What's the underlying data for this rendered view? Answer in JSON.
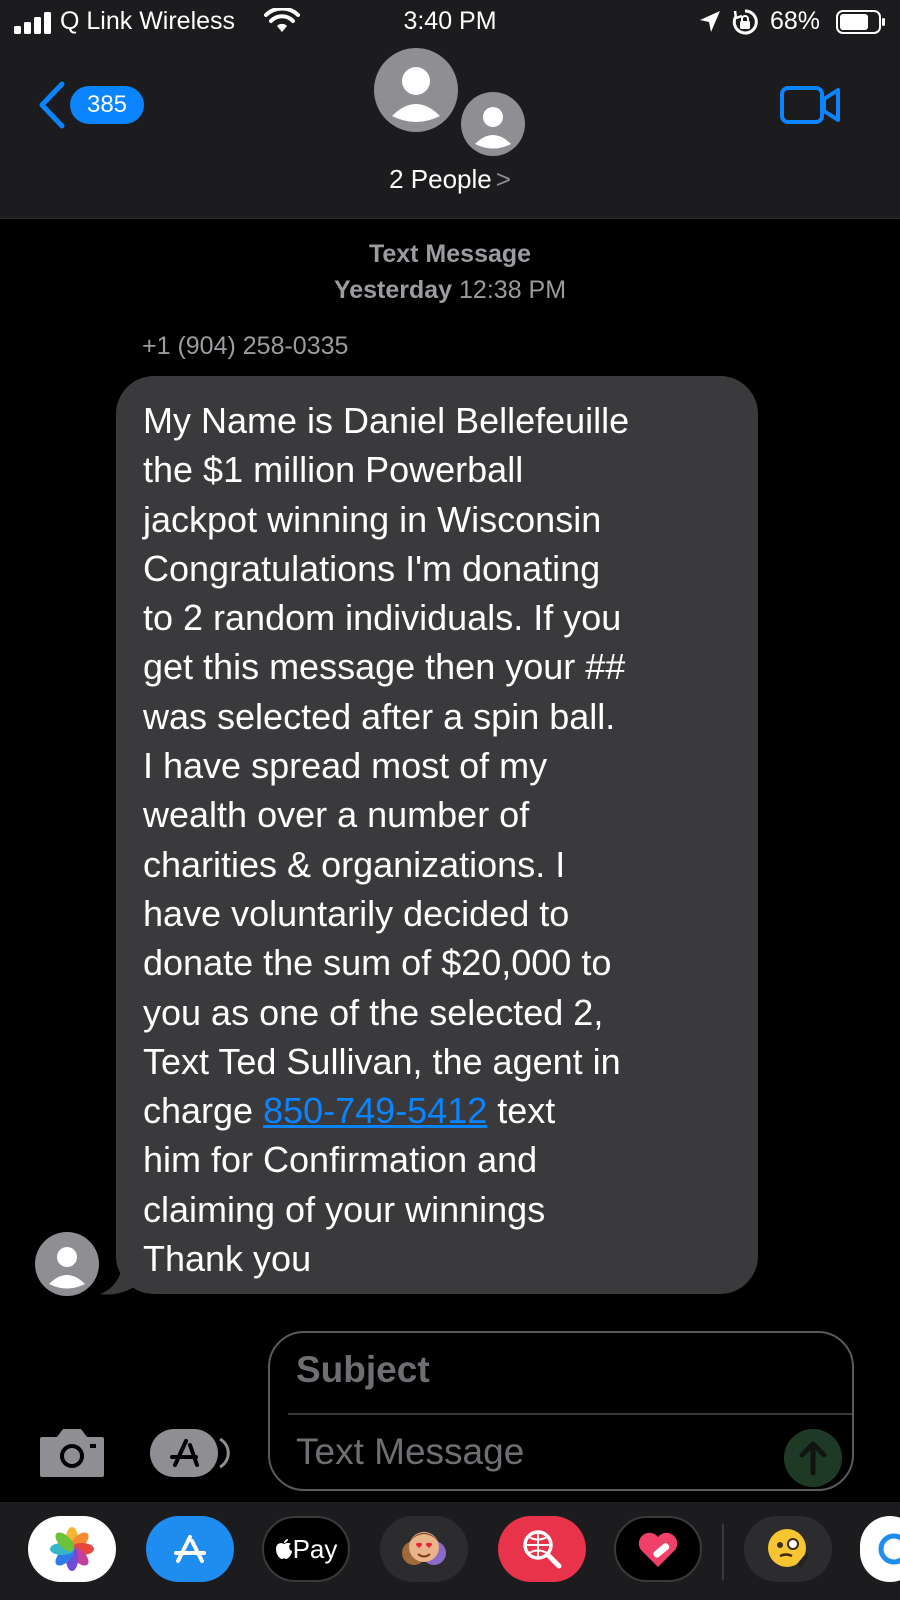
{
  "status_bar": {
    "carrier": "Q Link Wireless",
    "time": "3:40 PM",
    "battery": "68%"
  },
  "header": {
    "unread_count": "385",
    "group_title": "2 People",
    "chevron": ">"
  },
  "conversation": {
    "message_type": "Text Message",
    "timestamp_day": "Yesterday",
    "timestamp_time": "12:38 PM",
    "sender": "+1 (904) 258-0335",
    "message_before_link": "My Name is Daniel Bellefeuille\nthe $1 million Powerball\njackpot winning  in Wisconsin\nCongratulations I'm donating\nto 2 random individuals. If you\nget this message then your ##\nwas selected after a spin ball.\nI have spread most of my\nwealth over a number of\ncharities & organizations. I\nhave voluntarily decided to\ndonate the sum of  $20,000  to\nyou as one of the selected 2,\nText  Ted Sullivan, the agent in\ncharge ",
    "link_text": "850-749-5412",
    "message_after_link": "  text\nhim for Confirmation and\nclaiming of your winnings\nThank you"
  },
  "compose": {
    "subject_placeholder": "Subject",
    "message_placeholder": "Text Message"
  },
  "app_tray": {
    "apple_pay_label": "Pay",
    "items": [
      "photos-icon",
      "app-store-icon",
      "apple-pay-icon",
      "memoji-icon",
      "search-images-icon",
      "digital-touch-icon",
      "animoji-icon"
    ]
  },
  "colors": {
    "accent": "#0a84ff",
    "bubble": "#3a3a3c",
    "header": "#1c1c1e",
    "background": "#000000"
  }
}
